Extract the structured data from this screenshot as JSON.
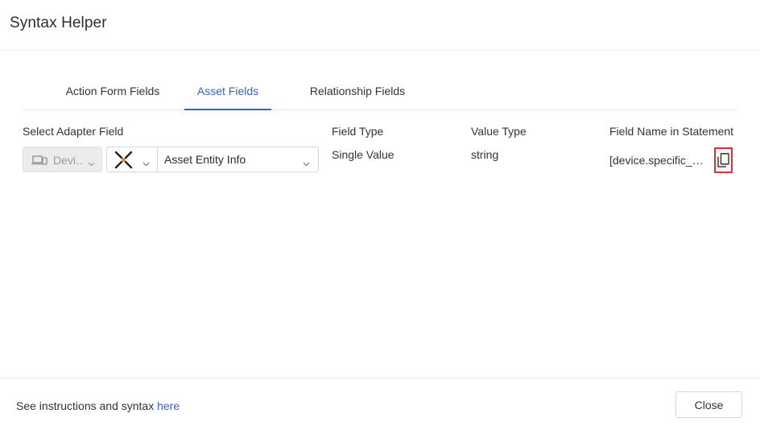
{
  "dialog": {
    "title": "Syntax Helper"
  },
  "tabs": [
    {
      "label": "Action Form Fields",
      "active": false
    },
    {
      "label": "Asset Fields",
      "active": true
    },
    {
      "label": "Relationship Fields",
      "active": false
    }
  ],
  "columns": {
    "adapter_field": "Select Adapter Field",
    "field_type": "Field Type",
    "value_type": "Value Type",
    "field_name": "Field Name in Statement"
  },
  "row": {
    "entity_select": {
      "value": "Devi…",
      "icon": "devices-icon"
    },
    "adapter_select": {
      "icon": "adapter-x-icon"
    },
    "field_select": {
      "value": "Asset Entity Info"
    },
    "field_type": "Single Value",
    "value_type": "string",
    "field_name": "[device.specific_data.data.asset_entity_info]",
    "copy_icon": "copy-icon"
  },
  "footer": {
    "text": "See instructions and syntax ",
    "link": "here",
    "close_label": "Close"
  },
  "colors": {
    "accent": "#3a64b8",
    "highlight_border": "#e03131"
  }
}
